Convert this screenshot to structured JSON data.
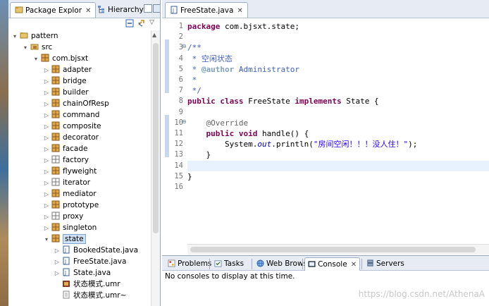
{
  "explorer": {
    "tabs": [
      {
        "label": "Package Explor",
        "close": "✕",
        "active": true
      },
      {
        "label": "Hierarchy",
        "active": false
      }
    ],
    "tree": [
      {
        "label": "pattern",
        "icon": "project-icon",
        "twisty": "▾",
        "depth": 0
      },
      {
        "label": "src",
        "icon": "source-folder-icon",
        "twisty": "▾",
        "depth": 1
      },
      {
        "label": "com.bjsxt",
        "icon": "package-icon",
        "twisty": "▾",
        "depth": 2
      },
      {
        "label": "adapter",
        "icon": "package-icon",
        "twisty": "▷",
        "depth": 3
      },
      {
        "label": "bridge",
        "icon": "package-icon",
        "twisty": "▷",
        "depth": 3
      },
      {
        "label": "builder",
        "icon": "package-icon",
        "twisty": "▷",
        "depth": 3
      },
      {
        "label": "chainOfResp",
        "icon": "package-icon",
        "twisty": "▷",
        "depth": 3
      },
      {
        "label": "command",
        "icon": "package-icon",
        "twisty": "▷",
        "depth": 3
      },
      {
        "label": "composite",
        "icon": "package-icon",
        "twisty": "▷",
        "depth": 3
      },
      {
        "label": "decorator",
        "icon": "package-icon",
        "twisty": "▷",
        "depth": 3
      },
      {
        "label": "facade",
        "icon": "package-icon",
        "twisty": "▷",
        "depth": 3
      },
      {
        "label": "factory",
        "icon": "empty-package-icon",
        "twisty": "▷",
        "depth": 3
      },
      {
        "label": "flyweight",
        "icon": "package-icon",
        "twisty": "▷",
        "depth": 3
      },
      {
        "label": "iterator",
        "icon": "empty-package-icon",
        "twisty": "▷",
        "depth": 3
      },
      {
        "label": "mediator",
        "icon": "package-icon",
        "twisty": "▷",
        "depth": 3
      },
      {
        "label": "prototype",
        "icon": "package-icon",
        "twisty": "▷",
        "depth": 3
      },
      {
        "label": "proxy",
        "icon": "empty-package-icon",
        "twisty": "▷",
        "depth": 3
      },
      {
        "label": "singleton",
        "icon": "package-icon",
        "twisty": "▷",
        "depth": 3
      },
      {
        "label": "state",
        "icon": "package-icon",
        "twisty": "▾",
        "depth": 3,
        "selected": true
      },
      {
        "label": "BookedState.java",
        "icon": "java-file-icon",
        "twisty": "▷",
        "depth": 4
      },
      {
        "label": "FreeState.java",
        "icon": "java-file-icon",
        "twisty": "▷",
        "depth": 4
      },
      {
        "label": "State.java",
        "icon": "java-file-icon",
        "twisty": "▷",
        "depth": 4
      },
      {
        "label": "状态模式.umr",
        "icon": "uml-file-icon",
        "twisty": "",
        "depth": 4
      },
      {
        "label": "状态模式.umr~",
        "icon": "text-file-icon",
        "twisty": "",
        "depth": 4
      }
    ]
  },
  "editor": {
    "tab": {
      "label": "FreeState.java",
      "close": "✕"
    },
    "line_numbers": [
      "1",
      "2",
      "3",
      "4",
      "5",
      "6",
      "7",
      "8",
      "9",
      "10",
      "11",
      "12",
      "13",
      "14",
      "15",
      "16"
    ],
    "fold_markers": {
      "3": "⊖",
      "10": "⊖"
    },
    "current_line": 14,
    "lines": [
      [
        {
          "t": "kw",
          "v": "package"
        },
        {
          "t": "",
          "v": " com.bjsxt.state;"
        }
      ],
      [],
      [
        {
          "t": "cm",
          "v": "/**"
        }
      ],
      [
        {
          "t": "cm",
          "v": " * 空闲状态"
        }
      ],
      [
        {
          "t": "cm",
          "v": " * "
        },
        {
          "t": "tag",
          "v": "@author"
        },
        {
          "t": "cm",
          "v": " Administrator"
        }
      ],
      [
        {
          "t": "cm",
          "v": " *"
        }
      ],
      [
        {
          "t": "cm",
          "v": " */"
        }
      ],
      [
        {
          "t": "kw",
          "v": "public class"
        },
        {
          "t": "",
          "v": " FreeState "
        },
        {
          "t": "kw",
          "v": "implements"
        },
        {
          "t": "",
          "v": " State {"
        }
      ],
      [],
      [
        {
          "t": "an",
          "v": "    @Override"
        }
      ],
      [
        {
          "t": "kw",
          "v": "    public void"
        },
        {
          "t": "",
          "v": " handle() {"
        }
      ],
      [
        {
          "t": "",
          "v": "        System."
        },
        {
          "t": "fld",
          "v": "out"
        },
        {
          "t": "",
          "v": ".println("
        },
        {
          "t": "st",
          "v": "\"房间空闲！！！没人住！\""
        },
        {
          "t": "",
          "v": ");"
        }
      ],
      [
        {
          "t": "",
          "v": "    }"
        }
      ],
      [],
      [
        {
          "t": "",
          "v": "}"
        }
      ],
      []
    ]
  },
  "bottom": {
    "tabs": [
      {
        "label": "Problems",
        "icon": "problems-icon"
      },
      {
        "label": "Tasks",
        "icon": "tasks-icon"
      },
      {
        "label": "Web Browser",
        "icon": "globe-icon"
      },
      {
        "label": "Console",
        "icon": "console-icon",
        "active": true,
        "close": "✕"
      },
      {
        "label": "Servers",
        "icon": "servers-icon"
      }
    ],
    "message": "No consoles to display at this time."
  },
  "watermark": "https://blog.csdn.net/AthenaA"
}
